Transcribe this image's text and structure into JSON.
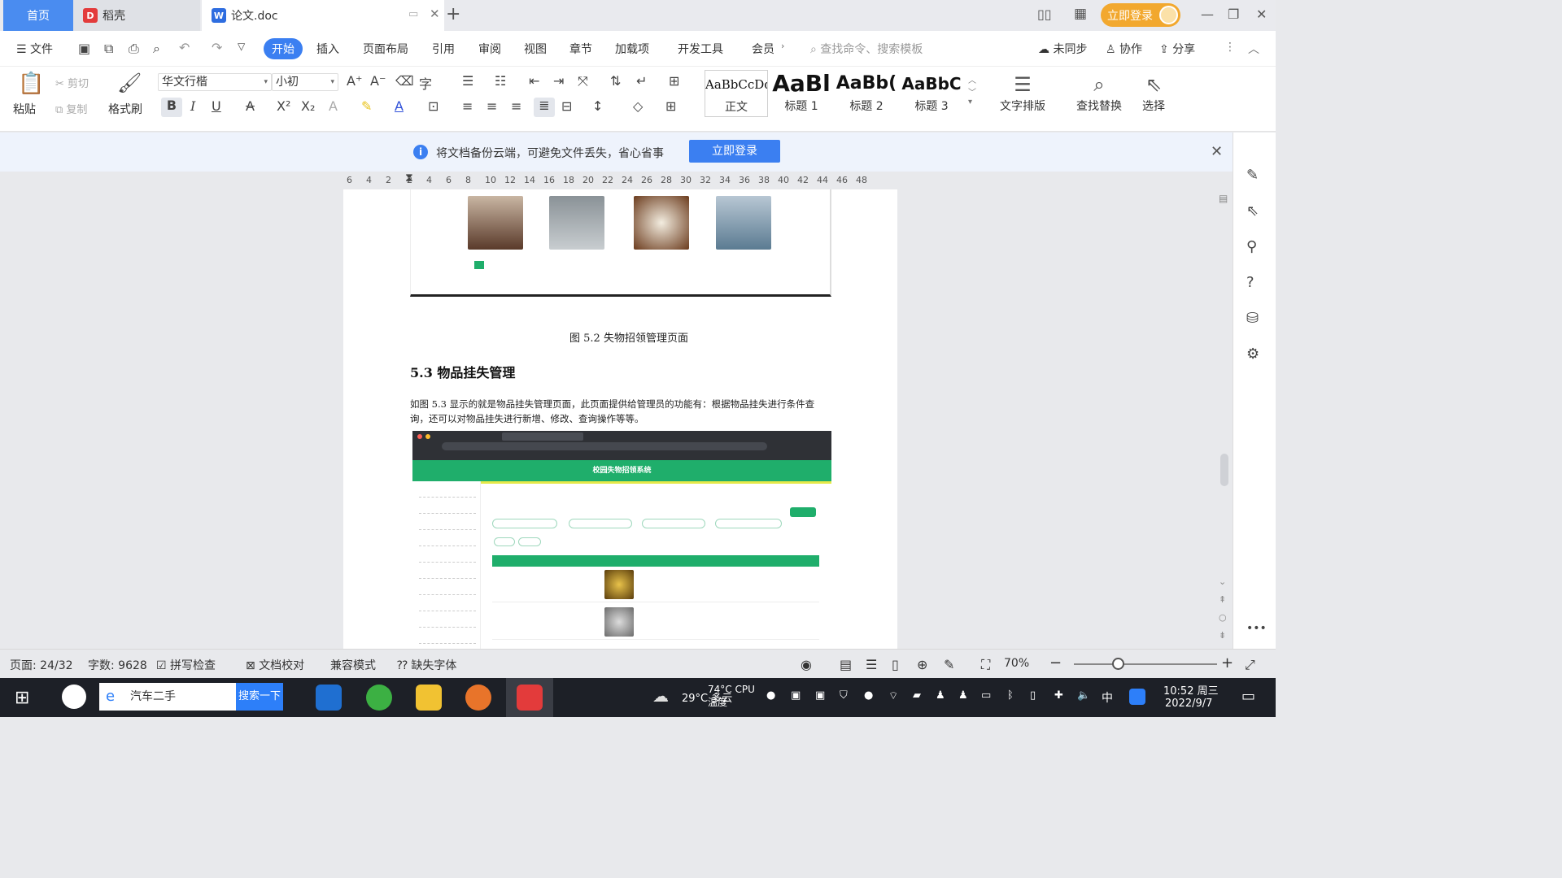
{
  "titlebar": {
    "tabs": [
      {
        "label": "首页"
      },
      {
        "label": "稻壳"
      },
      {
        "label": "论文.doc"
      }
    ],
    "login": "立即登录"
  },
  "menubar": {
    "file": "文件",
    "tabs": [
      "开始",
      "插入",
      "页面布局",
      "引用",
      "审阅",
      "视图",
      "章节",
      "加载项",
      "开发工具",
      "会员"
    ],
    "search_placeholder": "查找命令、搜索模板",
    "sync": "未同步",
    "collab": "协作",
    "share": "分享"
  },
  "ribbon": {
    "paste": "粘贴",
    "cut": "剪切",
    "copy": "复制",
    "format_painter": "格式刷",
    "font_name": "华文行楷",
    "font_size": "小初",
    "styles": [
      {
        "preview": "AaBbCcDd",
        "label": "正文"
      },
      {
        "preview": "AaBl",
        "label": "标题 1"
      },
      {
        "preview": "AaBb(",
        "label": "标题 2"
      },
      {
        "preview": "AaBbC",
        "label": "标题 3"
      }
    ],
    "text_layout": "文字排版",
    "find_replace": "查找替换",
    "select": "选择"
  },
  "notification": {
    "text": "将文档备份云端，可避免文件丢失，省心省事",
    "button": "立即登录"
  },
  "ruler": {
    "ticks": [
      "6",
      "4",
      "2",
      "2",
      "4",
      "6",
      "8",
      "10",
      "12",
      "14",
      "16",
      "18",
      "20",
      "22",
      "24",
      "26",
      "28",
      "30",
      "32",
      "34",
      "36",
      "38",
      "40",
      "42",
      "44",
      "46",
      "48"
    ]
  },
  "document": {
    "caption": "图 5.2  失物招领管理页面",
    "heading": "5.3 物品挂失管理",
    "paragraph": "如图 5.3 显示的就是物品挂失管理页面，此页面提供给管理员的功能有：根据物品挂失进行条件查询，还可以对物品挂失进行新增、修改、查询操作等等。",
    "embedded_title": "校园失物招领系统"
  },
  "statusbar": {
    "page": "页面: 24/32",
    "words": "字数: 9628",
    "spell": "拼写检查",
    "proof": "文档校对",
    "compat": "兼容模式",
    "missing_font": "缺失字体",
    "zoom": "70%"
  },
  "taskbar": {
    "search_text": "汽车二手",
    "search_button": "搜索一下",
    "weather": "29°C 多云",
    "cpu": "74°C CPU温度",
    "ime": "中",
    "time": "10:52 周三",
    "date": "2022/9/7"
  },
  "colors": {
    "accent": "#3b7ff1",
    "login_orange": "#f2a82e",
    "green_header": "#1fae6b"
  }
}
